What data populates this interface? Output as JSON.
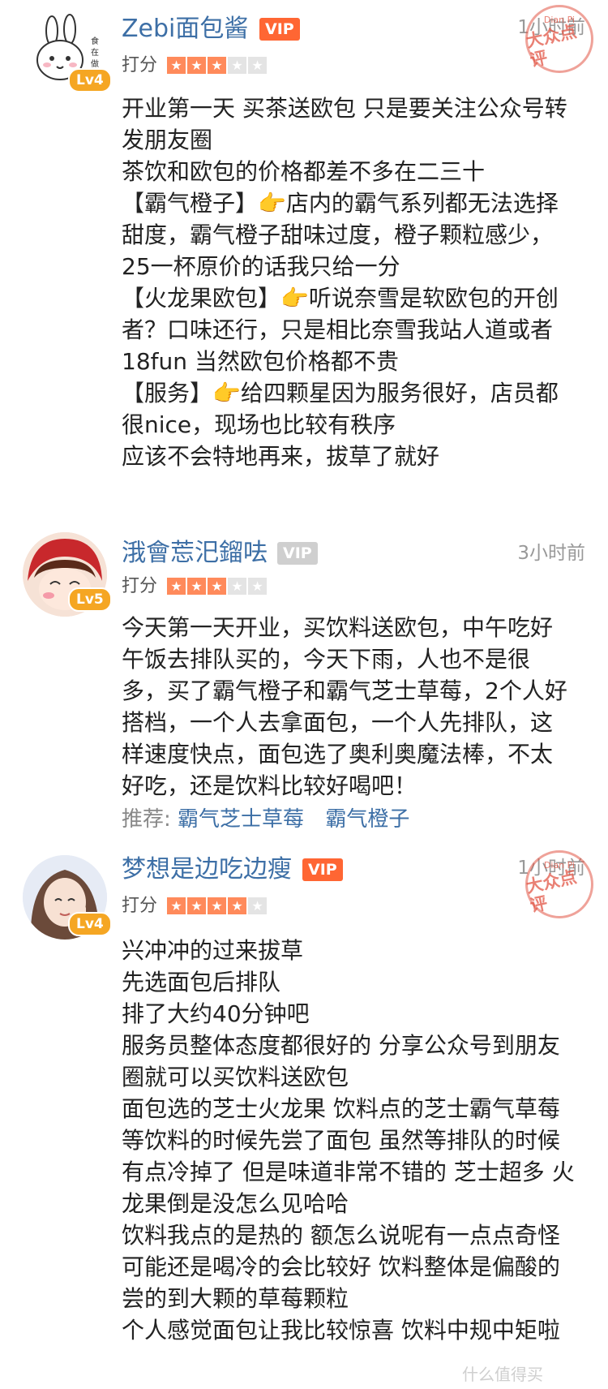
{
  "reviews": [
    {
      "username": "Zebi面包酱",
      "vip": "VIP",
      "level": "Lv4",
      "time": "1小时前",
      "rating_label": "打分",
      "stars": 3,
      "stamp_top": "Dian Pi",
      "stamp_text": "大众点评",
      "lines": [
        "开业第一天 买茶送欧包 只是要关注公众号转",
        "发朋友圈",
        "茶饮和欧包的价格都差不多在二三十",
        "【霸气橙子】👉店内的霸气系列都无法选择",
        "甜度，霸气橙子甜味过度，橙子颗粒感少，",
        "25一杯原价的话我只给一分",
        "【火龙果欧包】👉听说奈雪是软欧包的开创",
        "者？口味还行，只是相比奈雪我站人道或者",
        "18fun  当然欧包价格都不贵",
        "【服务】👉给四颗星因为服务很好，店员都",
        "很nice，现场也比较有秩序",
        "应该不会特地再来，拔草了就好"
      ]
    },
    {
      "username": "涐會莣汜鎦呿",
      "vip": "VIP",
      "level": "Lv5",
      "time": "3小时前",
      "rating_label": "打分",
      "stars": 3,
      "lines": [
        "今天第一天开业，买饮料送欧包，中午吃好",
        "午饭去排队买的，今天下雨，人也不是很",
        "多，买了霸气橙子和霸气芝士草莓，2个人好",
        "搭档，一个人去拿面包，一个人先排队，这",
        "样速度快点，面包选了奥利奥魔法棒，不太",
        "好吃，还是饮料比较好喝吧！"
      ],
      "recommend_label": "推荐:",
      "recommend_items": [
        "霸气芝士草莓",
        "霸气橙子"
      ]
    },
    {
      "username": "梦想是边吃边瘦",
      "vip": "VIP",
      "level": "Lv4",
      "time": "1小时前",
      "rating_label": "打分",
      "stars": 4,
      "stamp_top": "Dian Pi",
      "stamp_text": "大众点评",
      "lines": [
        "兴冲冲的过来拔草",
        "先选面包后排队",
        "排了大约40分钟吧",
        "服务员整体态度都很好的 分享公众号到朋友",
        "圈就可以买饮料送欧包",
        "面包选的芝士火龙果 饮料点的芝士霸气草莓",
        "等饮料的时候先尝了面包 虽然等排队的时候",
        "有点冷掉了 但是味道非常不错的 芝士超多 火",
        "龙果倒是没怎么见哈哈",
        "饮料我点的是热的 额怎么说呢有一点点奇怪",
        "可能还是喝冷的会比较好 饮料整体是偏酸的",
        "尝的到大颗的草莓颗粒",
        "个人感觉面包让我比较惊喜 饮料中规中矩啦"
      ]
    }
  ],
  "watermark": "什么值得买"
}
